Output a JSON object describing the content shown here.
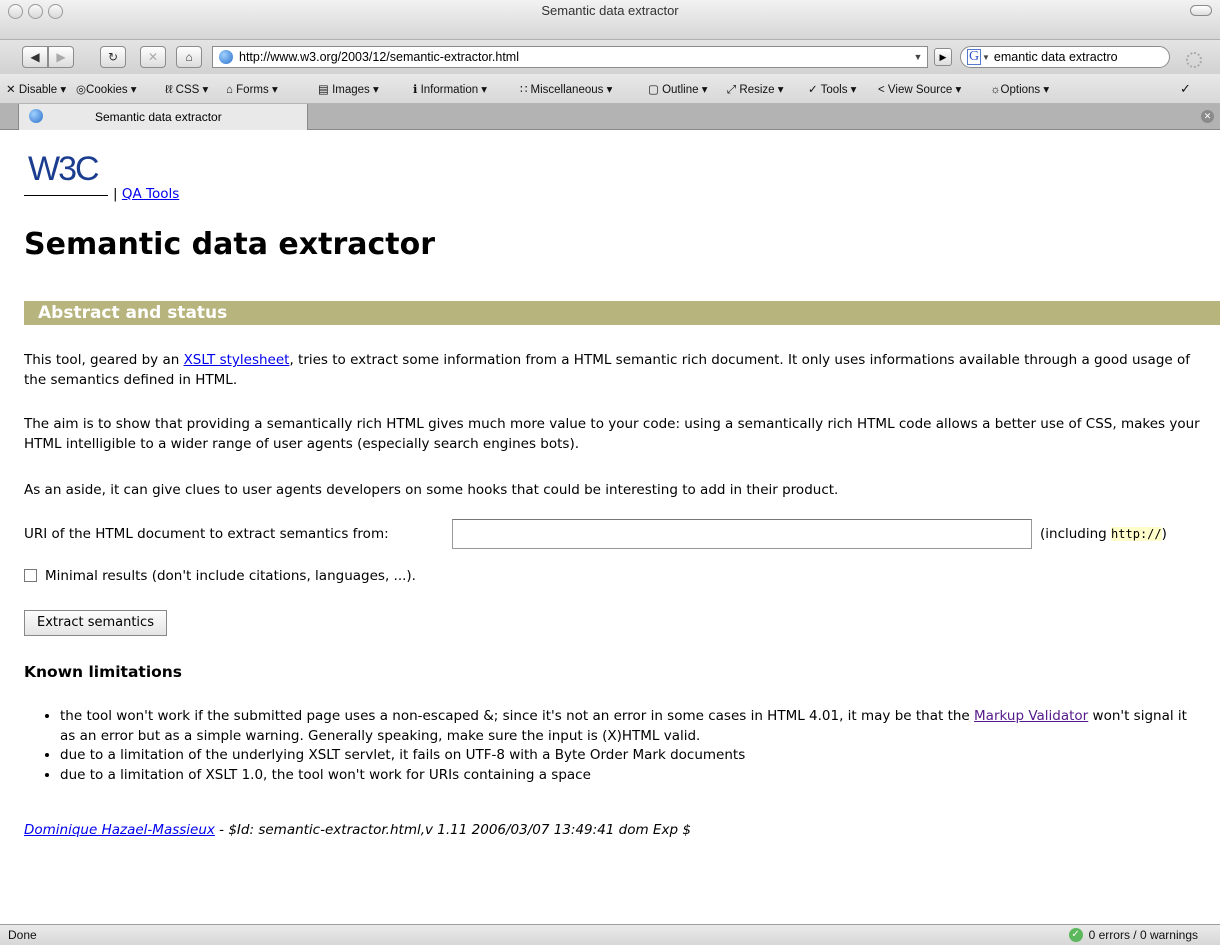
{
  "window": {
    "title": "Semantic data extractor"
  },
  "navbar": {
    "back_icon": "back-arrow",
    "forward_icon": "forward-arrow",
    "reload_icon": "reload",
    "stop_icon": "stop",
    "home_icon": "home",
    "url": "http://www.w3.org/2003/12/semantic-extractor.html",
    "search_engine": "G",
    "search_text": "emantic data extractro"
  },
  "webdev_toolbar": {
    "items": [
      "Disable",
      "Cookies",
      "CSS",
      "Forms",
      "Images",
      "Information",
      "Miscellaneous",
      "Outline",
      "Resize",
      "Tools",
      "View Source",
      "Options"
    ]
  },
  "tab": {
    "title": "Semantic data extractor"
  },
  "page": {
    "logo_text": "W3C",
    "qa_sep": "|",
    "qa_link": "QA Tools",
    "heading": "Semantic data extractor",
    "section_title": "Abstract and status",
    "p1_before": "This tool, geared by an ",
    "p1_link": "XSLT stylesheet",
    "p1_after": ", tries to extract some information from a HTML semantic rich document. It only uses informations available through a good usage of the semantics defined in HTML.",
    "p2": "The aim is to show that providing a semantically rich HTML gives much more value to your code: using a semantically rich HTML code allows a better use of CSS, makes your HTML intelligible to a wider range of user agents (especially search engines bots).",
    "p3": "As an aside, it can give clues to user agents developers on some hooks that could be interesting to add in their product.",
    "form_label": "URI of the HTML document to extract semantics from:",
    "uri_value": "",
    "form_after_open": "(including ",
    "form_after_code": "http://",
    "form_after_close": ")",
    "checkbox_label": "Minimal results (don't include citations, languages, ...).",
    "submit_label": "Extract semantics",
    "limits_heading": "Known limitations",
    "lim1_before": "the tool won't work if the submitted page uses a non-escaped &; since it's not an error in some cases in HTML 4.01, it may be that the ",
    "lim1_link": "Markup Validator",
    "lim1_after": " won't signal it as an error but as a simple warning. Generally speaking, make sure the input is (X)HTML valid.",
    "lim2": "due to a limitation of the underlying XSLT servlet, it fails on UTF-8 with a Byte Order Mark documents",
    "lim3": "due to a limitation of XSLT 1.0, the tool won't work for URIs containing a space",
    "author_link": "Dominique Hazael-Massieux",
    "revision": " - $Id: semantic-extractor.html,v 1.11 2006/03/07 13:49:41 dom Exp $"
  },
  "status": {
    "text": "Done",
    "validation": "0 errors / 0 warnings"
  }
}
